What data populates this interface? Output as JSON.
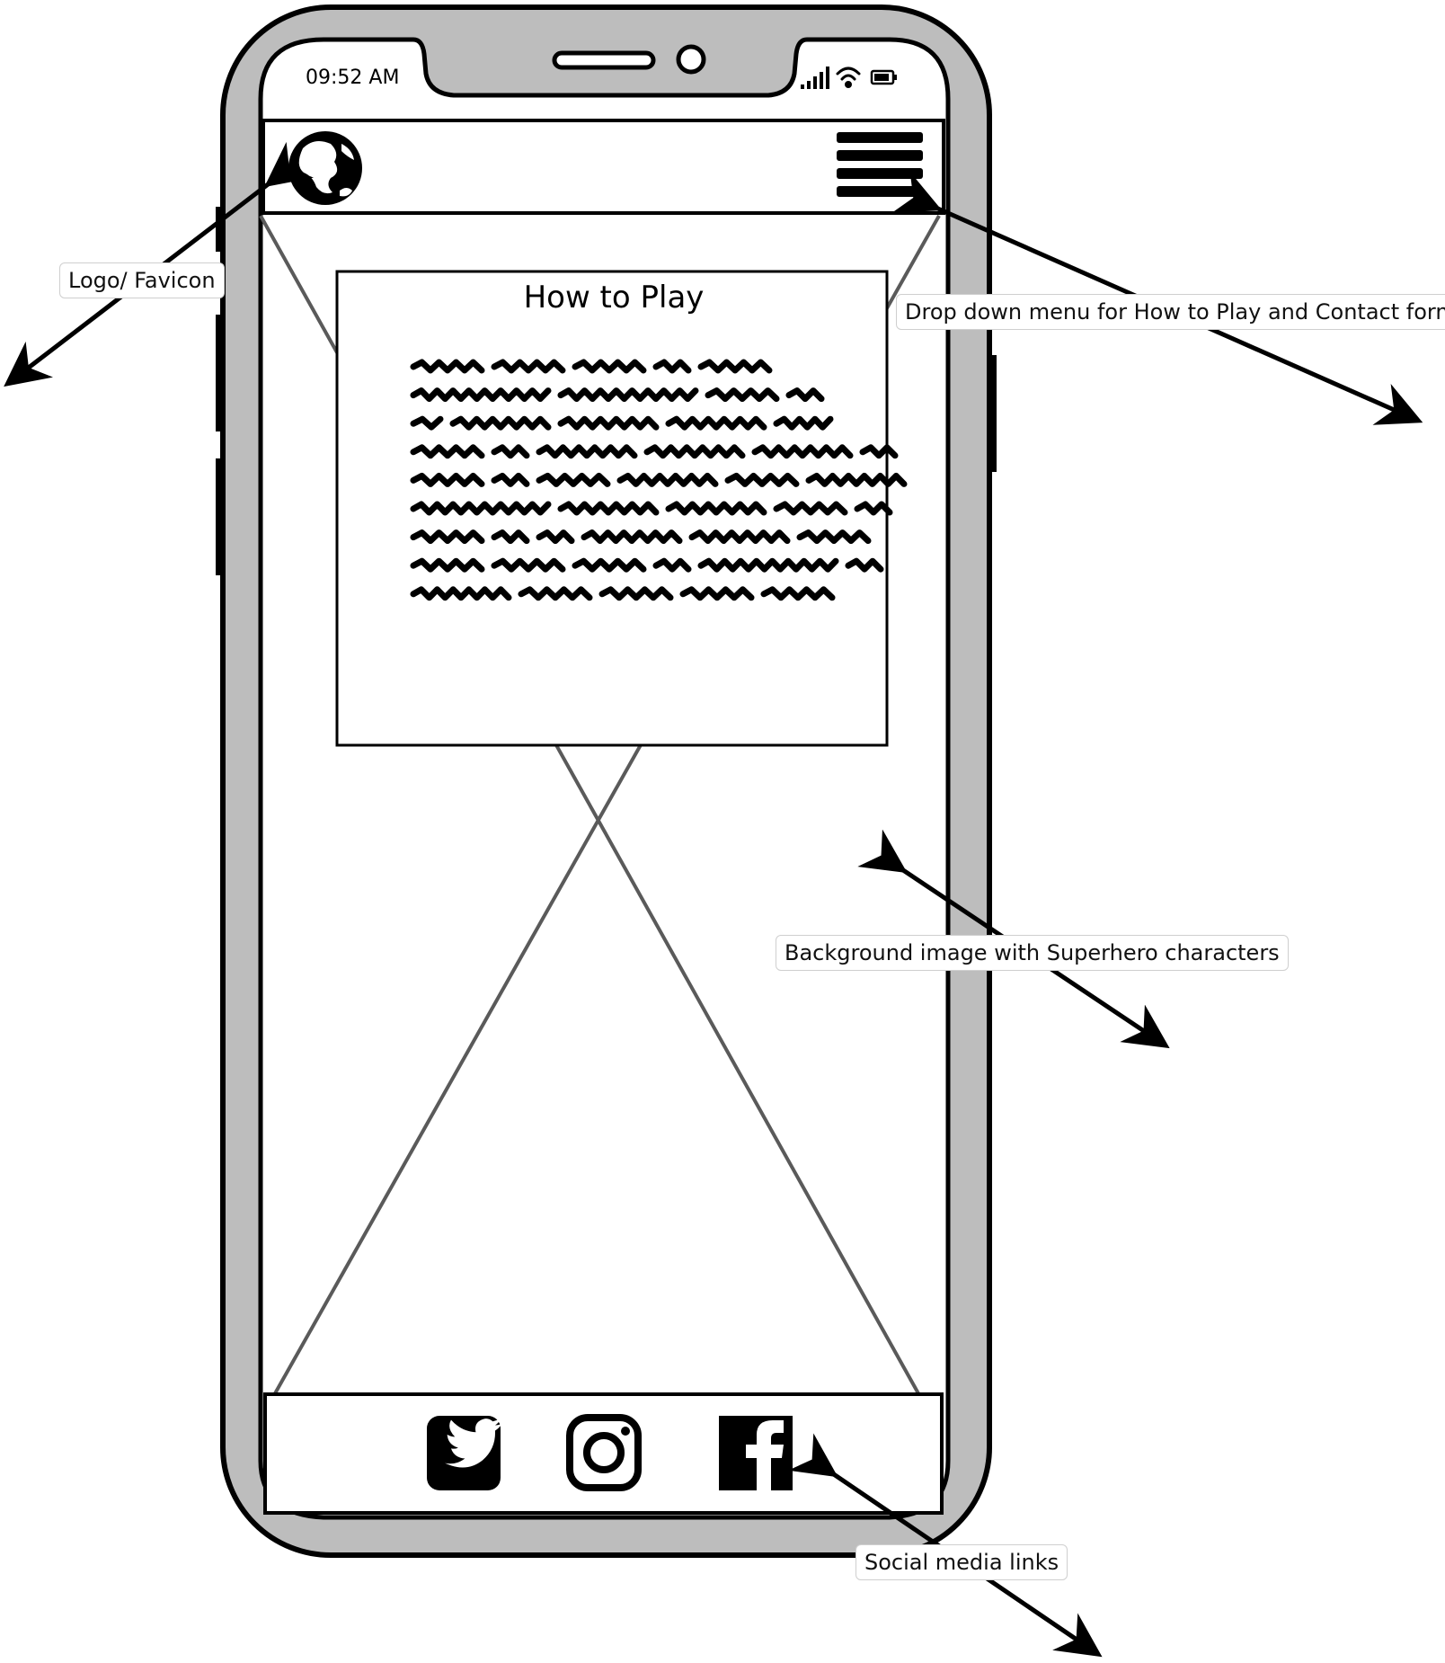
{
  "status_bar": {
    "time": "09:52 AM"
  },
  "header": {
    "logo_icon": "globe-icon",
    "menu_icon": "hamburger-menu-icon"
  },
  "modal": {
    "title": "How to Play"
  },
  "footer": {
    "social_icons": [
      "twitter-icon",
      "instagram-icon",
      "facebook-icon"
    ]
  },
  "annotations": {
    "logo": "Logo/ Favicon",
    "menu": "Drop down menu for How to Play and Contact form",
    "background": "Background image with Superhero characters",
    "social": "Social media links"
  },
  "colors": {
    "frame": "#bdbdbd",
    "ink": "#000000",
    "placeholder_line": "#5a5a5a"
  }
}
